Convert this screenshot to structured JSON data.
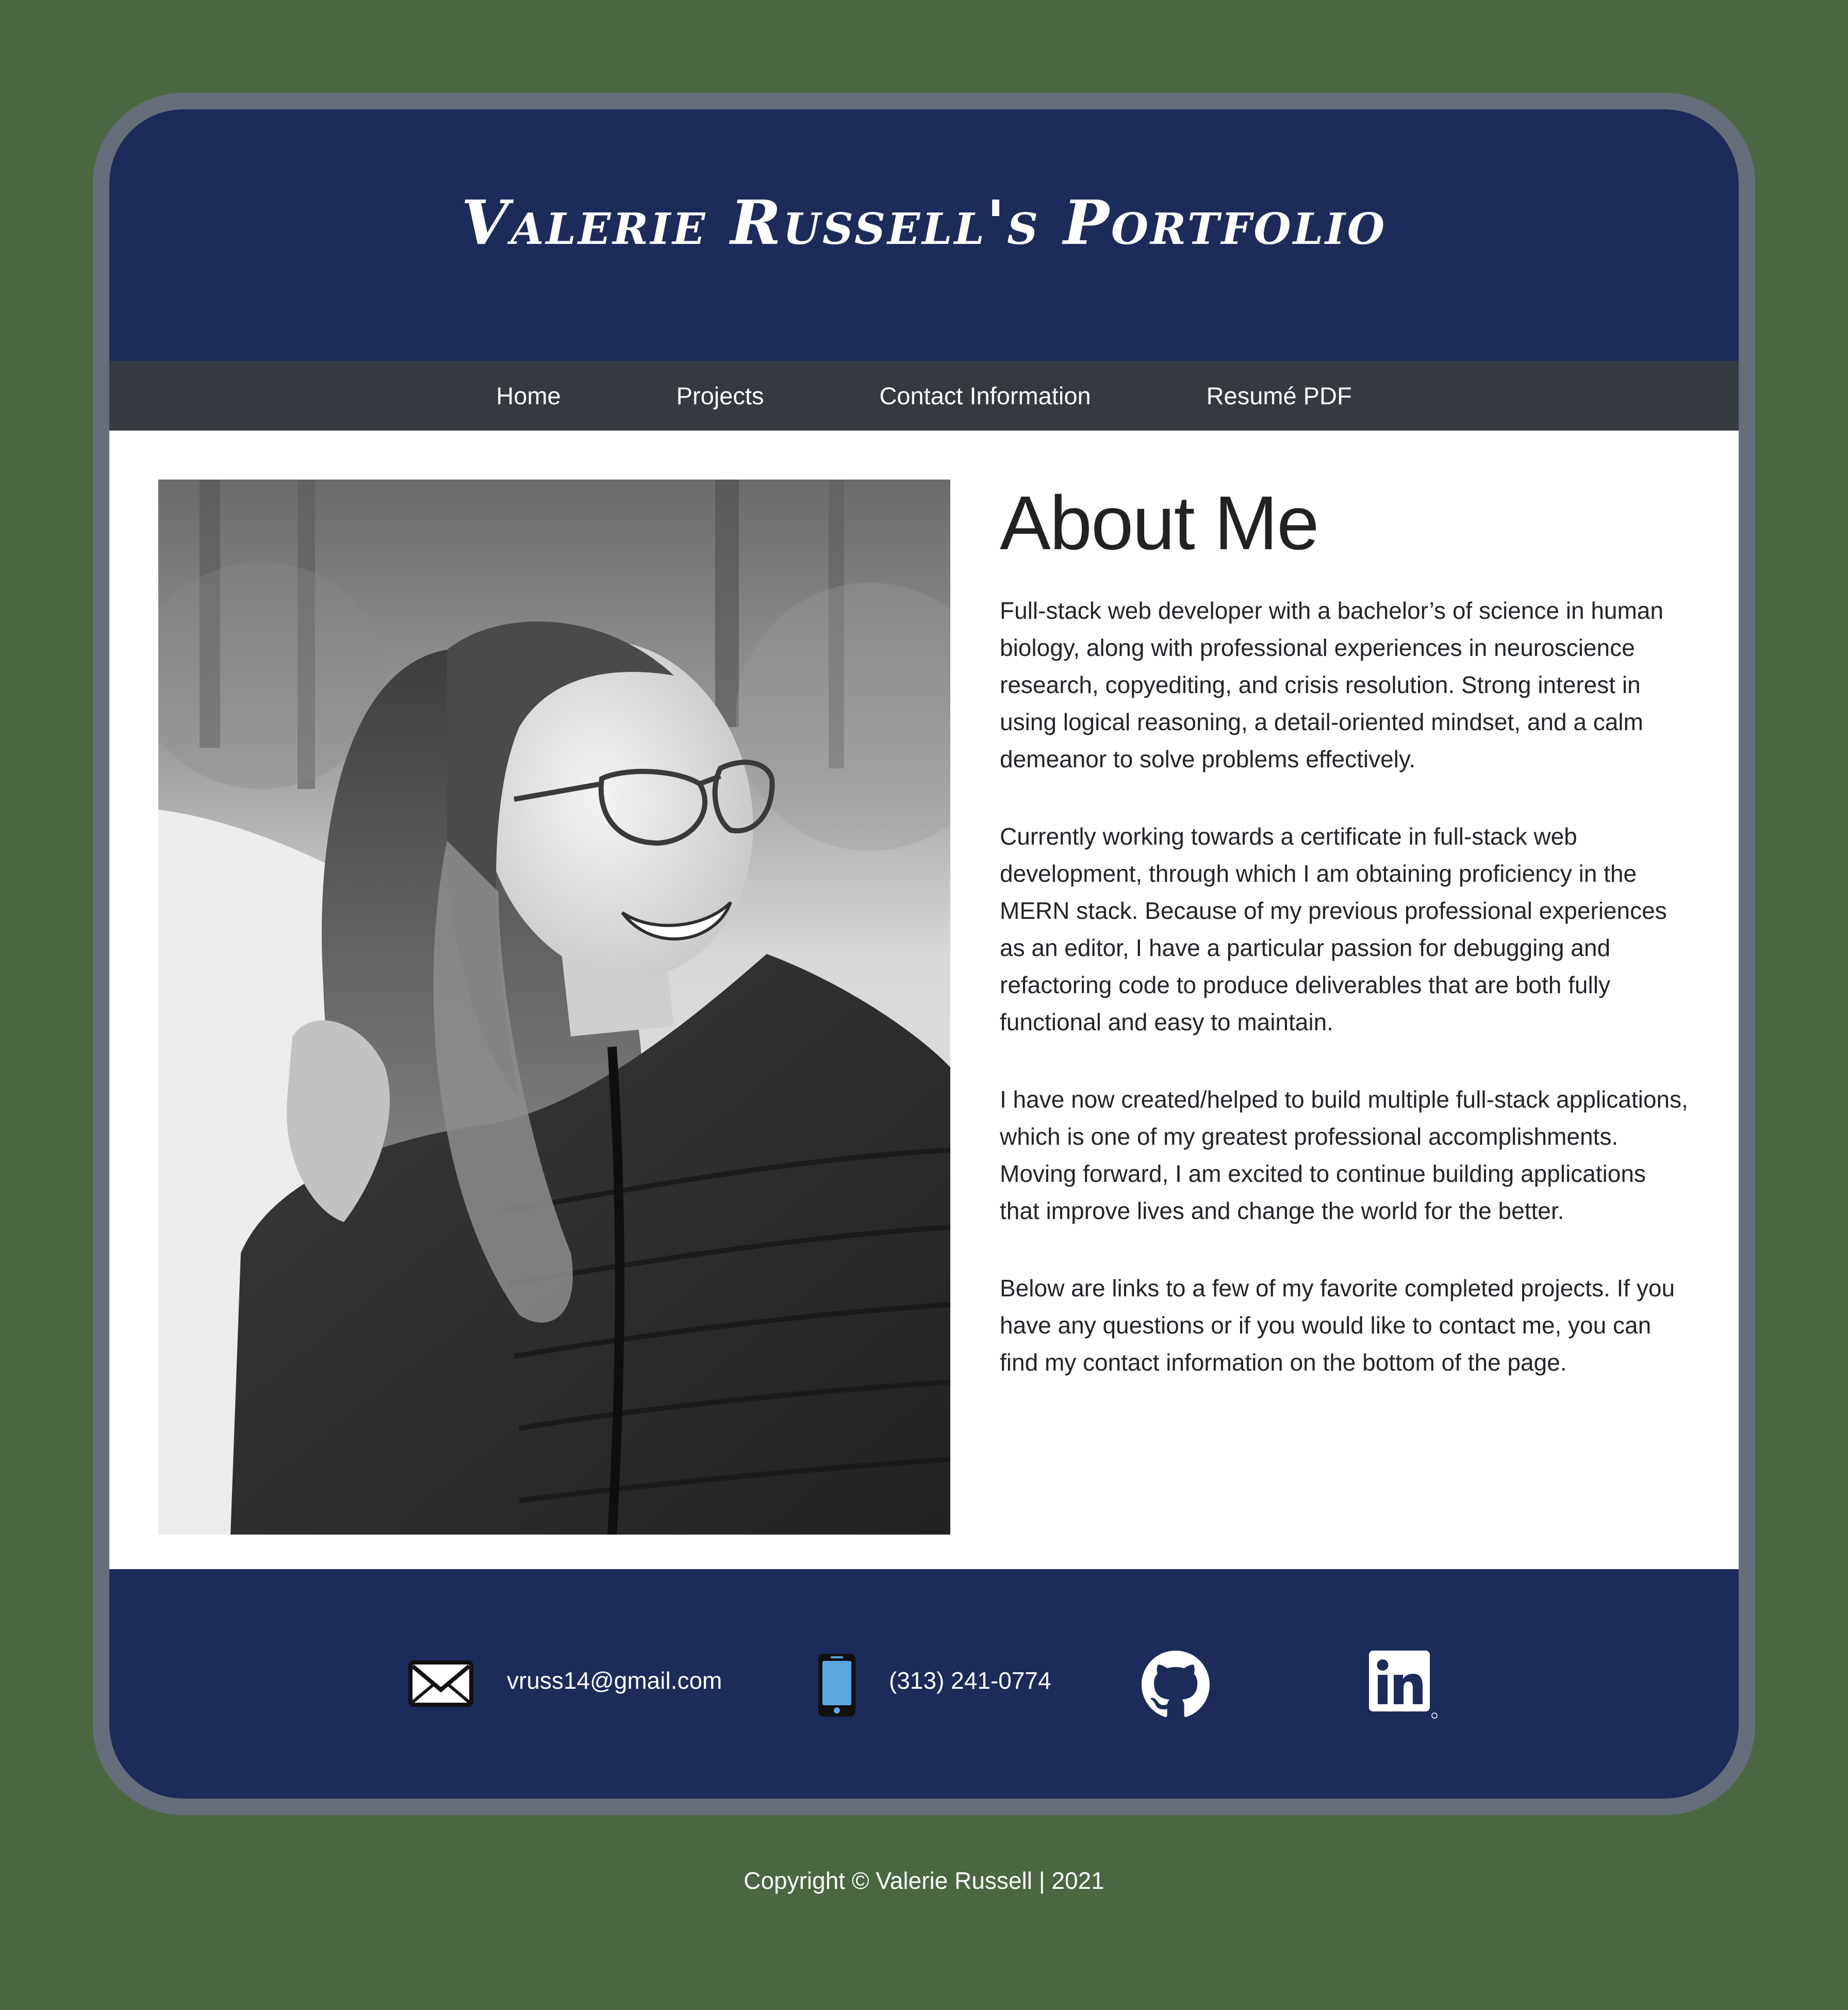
{
  "site": {
    "title": "Valerie Russell's Portfolio"
  },
  "nav": {
    "items": [
      {
        "label": "Home"
      },
      {
        "label": "Projects"
      },
      {
        "label": "Contact Information"
      },
      {
        "label": "Resumé PDF"
      }
    ]
  },
  "about": {
    "heading": "About Me",
    "photo_icon": "portrait-photo",
    "paragraphs": [
      "Full-stack web developer with a bachelor’s of science in human biology, along with professional experiences in neuroscience research, copyediting, and crisis resolution. Strong interest in using logical reasoning, a detail-oriented mindset, and a calm demeanor to solve problems effectively.",
      "Currently working towards a certificate in full-stack web development, through which I am obtaining proficiency in the MERN stack. Because of my previous professional experiences as an editor, I have a particular passion for debugging and refactoring code to produce deliverables that are both fully functional and easy to maintain.",
      "I have now created/helped to build multiple full-stack applications, which is one of my greatest professional accomplishments. Moving forward, I am excited to continue building applications that improve lives and change the world for the better.",
      "Below are links to a few of my favorite completed projects. If you have any questions or if you would like to contact me, you can find my contact information on the bottom of the page."
    ]
  },
  "contact": {
    "email": "vruss14@gmail.com",
    "phone": "(313) 241-0774",
    "icons": [
      "envelope-icon",
      "phone-icon",
      "github-icon",
      "linkedin-icon"
    ]
  },
  "footer": {
    "copyright": "Copyright © Valerie Russell | 2021"
  },
  "colors": {
    "background": "#4a6741",
    "frame": "#656d7a",
    "header": "#1c2b59",
    "nav": "#343a40",
    "text": "#212529"
  }
}
